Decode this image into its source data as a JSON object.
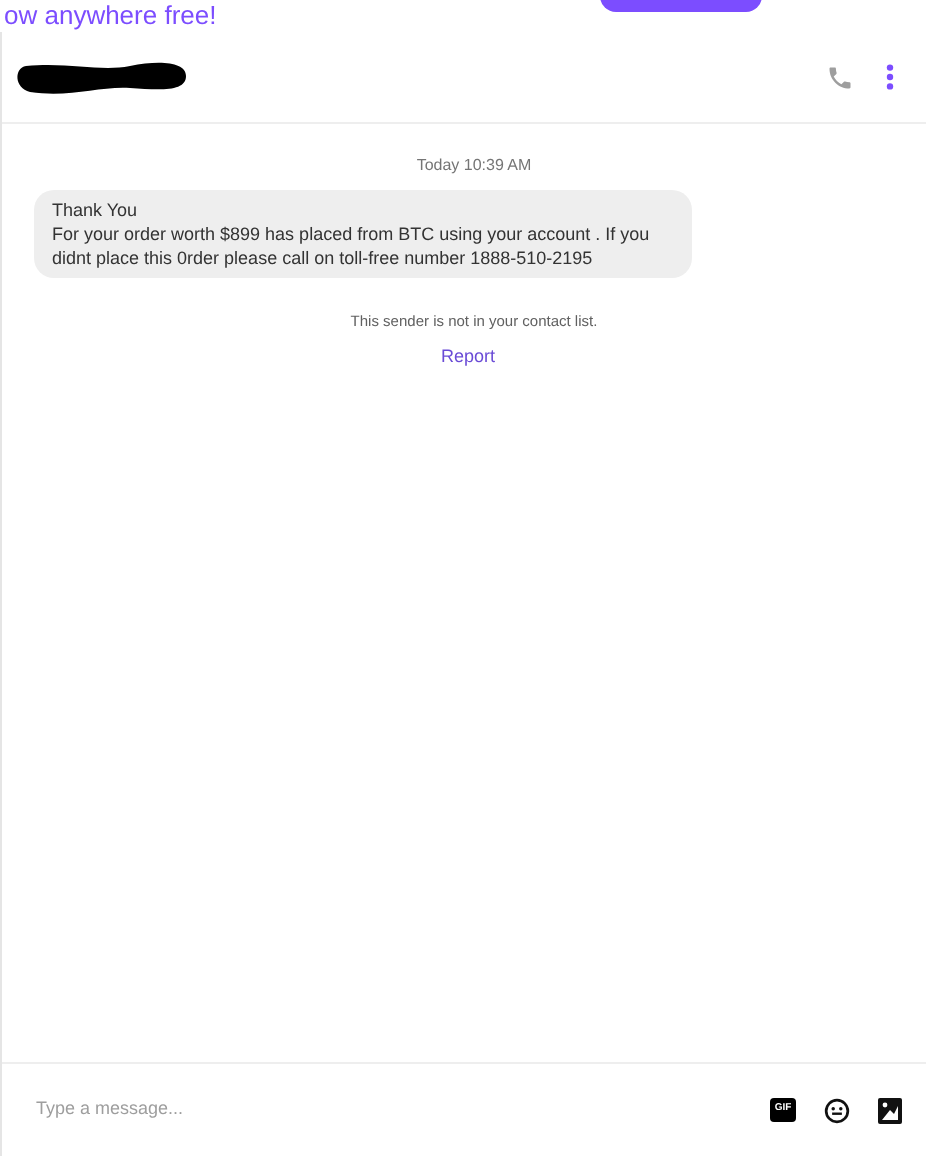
{
  "banner": {
    "headline": "ow anywhere free!"
  },
  "header": {
    "contact_name_redacted": true
  },
  "conversation": {
    "timestamp": "Today 10:39 AM",
    "messages": [
      {
        "lines": [
          "Thank You",
          "For your order worth $899 has placed from BTC using your account . If you didnt place this 0rder please call on toll-free number 1888-510-2195"
        ]
      }
    ],
    "notice": "This sender is not in your contact list.",
    "report_link": "Report"
  },
  "composer": {
    "placeholder": "Type a message...",
    "gif_label": "GIF"
  }
}
